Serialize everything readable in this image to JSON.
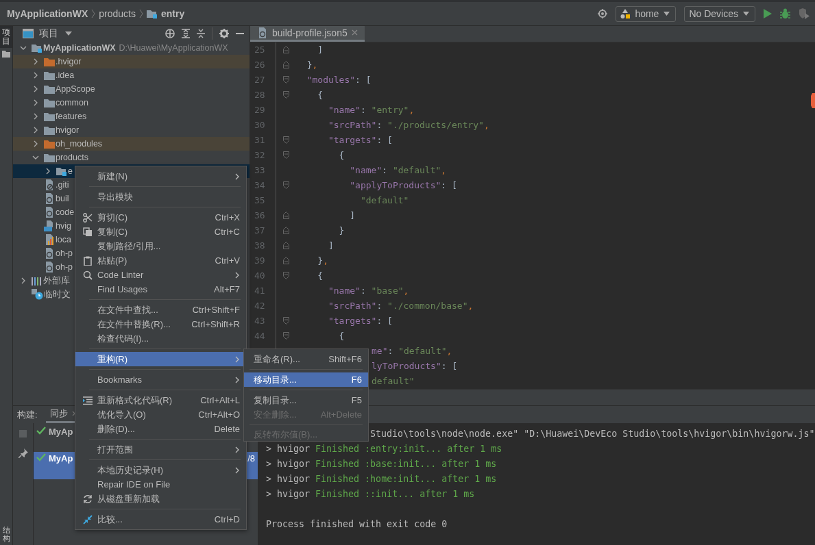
{
  "breadcrumbs": [
    {
      "label": "MyApplicationWX",
      "kind": "project"
    },
    {
      "label": "products",
      "kind": "plain"
    },
    {
      "label": "entry",
      "kind": "module"
    }
  ],
  "toolbar": {
    "config": "home",
    "device": "No Devices"
  },
  "left_strip": {
    "top": "项目",
    "bottom": "结构"
  },
  "project_panel": {
    "title": "项目",
    "tree": [
      {
        "label": "MyApplicationWX",
        "path": "D:\\Huawei\\MyApplicationWX",
        "kind": "module",
        "expanded": true,
        "selected": false,
        "excluded": false,
        "children": [
          {
            "label": ".hvigor",
            "kind": "folder",
            "expanded": false,
            "selected": false,
            "excluded": true
          },
          {
            "label": ".idea",
            "kind": "folder",
            "expanded": false,
            "selected": false,
            "excluded": false
          },
          {
            "label": "AppScope",
            "kind": "folder",
            "expanded": false,
            "selected": false,
            "excluded": false
          },
          {
            "label": "common",
            "kind": "folder",
            "expanded": false,
            "selected": false,
            "excluded": false
          },
          {
            "label": "features",
            "kind": "folder",
            "expanded": false,
            "selected": false,
            "excluded": false
          },
          {
            "label": "hvigor",
            "kind": "folder",
            "expanded": false,
            "selected": false,
            "excluded": false
          },
          {
            "label": "oh_modules",
            "kind": "folder",
            "expanded": false,
            "selected": false,
            "excluded": true
          },
          {
            "label": "products",
            "kind": "folder",
            "expanded": true,
            "selected": false,
            "excluded": false,
            "children": [
              {
                "label": "e",
                "kind": "module",
                "expanded": false,
                "selected": true,
                "excluded": false
              }
            ]
          },
          {
            "label": ".giti",
            "kind": "ignore",
            "selected": false,
            "excluded": false
          },
          {
            "label": "buil",
            "kind": "config",
            "selected": false,
            "excluded": false
          },
          {
            "label": "code",
            "kind": "config",
            "selected": false,
            "excluded": false
          },
          {
            "label": "hvig",
            "kind": "ts",
            "selected": false,
            "excluded": false
          },
          {
            "label": "loca",
            "kind": "props",
            "selected": false,
            "excluded": false
          },
          {
            "label": "oh-p",
            "kind": "config",
            "selected": false,
            "excluded": false
          },
          {
            "label": "oh-p",
            "kind": "config",
            "selected": false,
            "excluded": false
          }
        ]
      },
      {
        "label": "外部库",
        "kind": "library",
        "expanded": false,
        "selected": false,
        "excluded": false
      },
      {
        "label": "临时文",
        "kind": "scratch",
        "selected": false,
        "excluded": false
      }
    ]
  },
  "editor": {
    "tab": {
      "label": "build-profile.json5",
      "selected": true
    },
    "lines": [
      {
        "n": "25",
        "kind": "fold-close",
        "tokens": [
          {
            "t": "    ]",
            "kind": "punct"
          }
        ]
      },
      {
        "n": "26",
        "kind": "fold-close",
        "tokens": [
          {
            "t": "  }",
            "kind": "punct"
          },
          {
            "t": ",",
            "kind": "comma"
          }
        ]
      },
      {
        "n": "27",
        "kind": "fold-open",
        "tokens": [
          {
            "t": "  \"modules\"",
            "kind": "key"
          },
          {
            "t": ": [",
            "kind": "punct"
          }
        ]
      },
      {
        "n": "28",
        "kind": "fold-open",
        "tokens": [
          {
            "t": "    {",
            "kind": "punct"
          }
        ]
      },
      {
        "n": "29",
        "kind": "plain",
        "tokens": [
          {
            "t": "      \"name\"",
            "kind": "key"
          },
          {
            "t": ": ",
            "kind": "punct"
          },
          {
            "t": "\"entry\"",
            "kind": "str"
          },
          {
            "t": ",",
            "kind": "comma"
          }
        ]
      },
      {
        "n": "30",
        "kind": "plain",
        "tokens": [
          {
            "t": "      \"srcPath\"",
            "kind": "key"
          },
          {
            "t": ": ",
            "kind": "punct"
          },
          {
            "t": "\"./products/entry\"",
            "kind": "str"
          },
          {
            "t": ",",
            "kind": "comma"
          }
        ]
      },
      {
        "n": "31",
        "kind": "fold-open",
        "tokens": [
          {
            "t": "      \"targets\"",
            "kind": "key"
          },
          {
            "t": ": [",
            "kind": "punct"
          }
        ]
      },
      {
        "n": "32",
        "kind": "fold-open",
        "tokens": [
          {
            "t": "        {",
            "kind": "punct"
          }
        ]
      },
      {
        "n": "33",
        "kind": "plain",
        "tokens": [
          {
            "t": "          \"name\"",
            "kind": "key"
          },
          {
            "t": ": ",
            "kind": "punct"
          },
          {
            "t": "\"default\"",
            "kind": "str"
          },
          {
            "t": ",",
            "kind": "comma"
          }
        ]
      },
      {
        "n": "34",
        "kind": "fold-open",
        "tokens": [
          {
            "t": "          \"applyToProducts\"",
            "kind": "key"
          },
          {
            "t": ": [",
            "kind": "punct"
          }
        ]
      },
      {
        "n": "35",
        "kind": "plain",
        "tokens": [
          {
            "t": "            \"default\"",
            "kind": "str"
          }
        ]
      },
      {
        "n": "36",
        "kind": "fold-close",
        "tokens": [
          {
            "t": "          ]",
            "kind": "punct"
          }
        ]
      },
      {
        "n": "37",
        "kind": "fold-close",
        "tokens": [
          {
            "t": "        }",
            "kind": "punct"
          }
        ]
      },
      {
        "n": "38",
        "kind": "fold-close",
        "tokens": [
          {
            "t": "      ]",
            "kind": "punct"
          }
        ]
      },
      {
        "n": "39",
        "kind": "fold-close",
        "tokens": [
          {
            "t": "    }",
            "kind": "punct"
          },
          {
            "t": ",",
            "kind": "comma"
          }
        ]
      },
      {
        "n": "40",
        "kind": "fold-open",
        "tokens": [
          {
            "t": "    {",
            "kind": "punct"
          }
        ]
      },
      {
        "n": "41",
        "kind": "plain",
        "tokens": [
          {
            "t": "      \"name\"",
            "kind": "key"
          },
          {
            "t": ": ",
            "kind": "punct"
          },
          {
            "t": "\"base\"",
            "kind": "str"
          },
          {
            "t": ",",
            "kind": "comma"
          }
        ]
      },
      {
        "n": "42",
        "kind": "plain",
        "tokens": [
          {
            "t": "      \"srcPath\"",
            "kind": "key"
          },
          {
            "t": ": ",
            "kind": "punct"
          },
          {
            "t": "\"./common/base\"",
            "kind": "str"
          },
          {
            "t": ",",
            "kind": "comma"
          }
        ]
      },
      {
        "n": "43",
        "kind": "fold-open",
        "tokens": [
          {
            "t": "      \"targets\"",
            "kind": "key"
          },
          {
            "t": ": [",
            "kind": "punct"
          }
        ]
      },
      {
        "n": "44",
        "kind": "fold-open",
        "tokens": [
          {
            "t": "        {",
            "kind": "punct"
          }
        ]
      },
      {
        "kind": "partial",
        "tokens": [
          {
            "t": "me\"",
            "kind": "key"
          },
          {
            "t": ": ",
            "kind": "punct"
          },
          {
            "t": "\"default\"",
            "kind": "str"
          },
          {
            "t": ",",
            "kind": "comma"
          }
        ]
      },
      {
        "kind": "partial",
        "tokens": [
          {
            "t": "lyToProducts\"",
            "kind": "key"
          },
          {
            "t": ": [",
            "kind": "punct"
          }
        ]
      },
      {
        "kind": "partial",
        "tokens": [
          {
            "t": "default\"",
            "kind": "str"
          }
        ]
      }
    ]
  },
  "build": {
    "label": "构建:",
    "tab": {
      "label": "同步",
      "selected": true
    },
    "tree": [
      {
        "label": "MyAp",
        "selected": false
      },
      {
        "label": "MyAp",
        "time": "/8",
        "selected": true
      }
    ],
    "console": [
      {
        "kind": "command",
        "text": "Studio\\tools\\node\\node.exe\" \"D:\\Huawei\\DevEco Studio\\tools\\hvigor\\bin\\hvigorw.js\""
      },
      {
        "kind": "task",
        "prefix": "> hvigor",
        "text": "Finished :entry:init... after 1 ms"
      },
      {
        "kind": "task",
        "prefix": "> hvigor",
        "text": "Finished :base:init... after 1 ms"
      },
      {
        "kind": "task",
        "prefix": "> hvigor",
        "text": "Finished :home:init... after 1 ms"
      },
      {
        "kind": "task",
        "prefix": "> hvigor",
        "text": "Finished ::init... after 1 ms"
      },
      {
        "kind": "result",
        "text": "Process finished with exit code 0"
      }
    ]
  },
  "context_menu": [
    {
      "kind": "plain",
      "label": "新建(N)",
      "submenu": true,
      "selected": false,
      "disabled": false
    },
    {
      "kind": "separator"
    },
    {
      "kind": "plain",
      "label": "导出模块",
      "selected": false,
      "disabled": false
    },
    {
      "kind": "separator"
    },
    {
      "kind": "cut",
      "label": "剪切(C)",
      "shortcut": "Ctrl+X",
      "selected": false,
      "disabled": false
    },
    {
      "kind": "copy",
      "label": "复制(C)",
      "shortcut": "Ctrl+C",
      "selected": false,
      "disabled": false
    },
    {
      "kind": "plain",
      "label": "复制路径/引用...",
      "selected": false,
      "disabled": false
    },
    {
      "kind": "paste",
      "label": "粘贴(P)",
      "shortcut": "Ctrl+V",
      "selected": false,
      "disabled": false
    },
    {
      "kind": "linter",
      "label": "Code Linter",
      "submenu": true,
      "selected": false,
      "disabled": false
    },
    {
      "kind": "plain",
      "label": "Find Usages",
      "shortcut": "Alt+F7",
      "selected": false,
      "disabled": false
    },
    {
      "kind": "separator"
    },
    {
      "kind": "plain",
      "label": "在文件中查找...",
      "shortcut": "Ctrl+Shift+F",
      "selected": false,
      "disabled": false
    },
    {
      "kind": "plain",
      "label": "在文件中替换(R)...",
      "shortcut": "Ctrl+Shift+R",
      "selected": false,
      "disabled": false
    },
    {
      "kind": "plain",
      "label": "检查代码(I)...",
      "selected": false,
      "disabled": false
    },
    {
      "kind": "separator"
    },
    {
      "kind": "plain",
      "label": "重构(R)",
      "submenu": true,
      "selected": true,
      "disabled": false
    },
    {
      "kind": "separator"
    },
    {
      "kind": "plain",
      "label": "Bookmarks",
      "submenu": true,
      "selected": false,
      "disabled": false
    },
    {
      "kind": "separator"
    },
    {
      "kind": "format",
      "label": "重新格式化代码(R)",
      "shortcut": "Ctrl+Alt+L",
      "selected": false,
      "disabled": false
    },
    {
      "kind": "plain",
      "label": "优化导入(O)",
      "shortcut": "Ctrl+Alt+O",
      "selected": false,
      "disabled": false
    },
    {
      "kind": "plain",
      "label": "删除(D)...",
      "shortcut": "Delete",
      "selected": false,
      "disabled": false
    },
    {
      "kind": "separator"
    },
    {
      "kind": "plain",
      "label": "打开范围",
      "submenu": true,
      "selected": false,
      "disabled": false
    },
    {
      "kind": "separator"
    },
    {
      "kind": "plain",
      "label": "本地历史记录(H)",
      "submenu": true,
      "selected": false,
      "disabled": false
    },
    {
      "kind": "plain",
      "label": "Repair IDE on File",
      "selected": false,
      "disabled": false
    },
    {
      "kind": "reload",
      "label": "从磁盘重新加载",
      "selected": false,
      "disabled": false
    },
    {
      "kind": "separator"
    },
    {
      "kind": "compare",
      "label": "比较...",
      "shortcut": "Ctrl+D",
      "selected": false,
      "disabled": false
    }
  ],
  "submenu": [
    {
      "kind": "plain",
      "label": "重命名(R)...",
      "shortcut": "Shift+F6",
      "selected": false,
      "disabled": false
    },
    {
      "kind": "separator"
    },
    {
      "kind": "plain",
      "label": "移动目录...",
      "shortcut": "F6",
      "selected": true,
      "disabled": false
    },
    {
      "kind": "separator"
    },
    {
      "kind": "plain",
      "label": "复制目录...",
      "shortcut": "F5",
      "selected": false,
      "disabled": false
    },
    {
      "kind": "plain",
      "label": "安全删除...",
      "shortcut": "Alt+Delete",
      "selected": false,
      "disabled": true
    },
    {
      "kind": "separator"
    },
    {
      "kind": "plain",
      "label": "反转布尔值(B)...",
      "selected": false,
      "disabled": true
    }
  ]
}
